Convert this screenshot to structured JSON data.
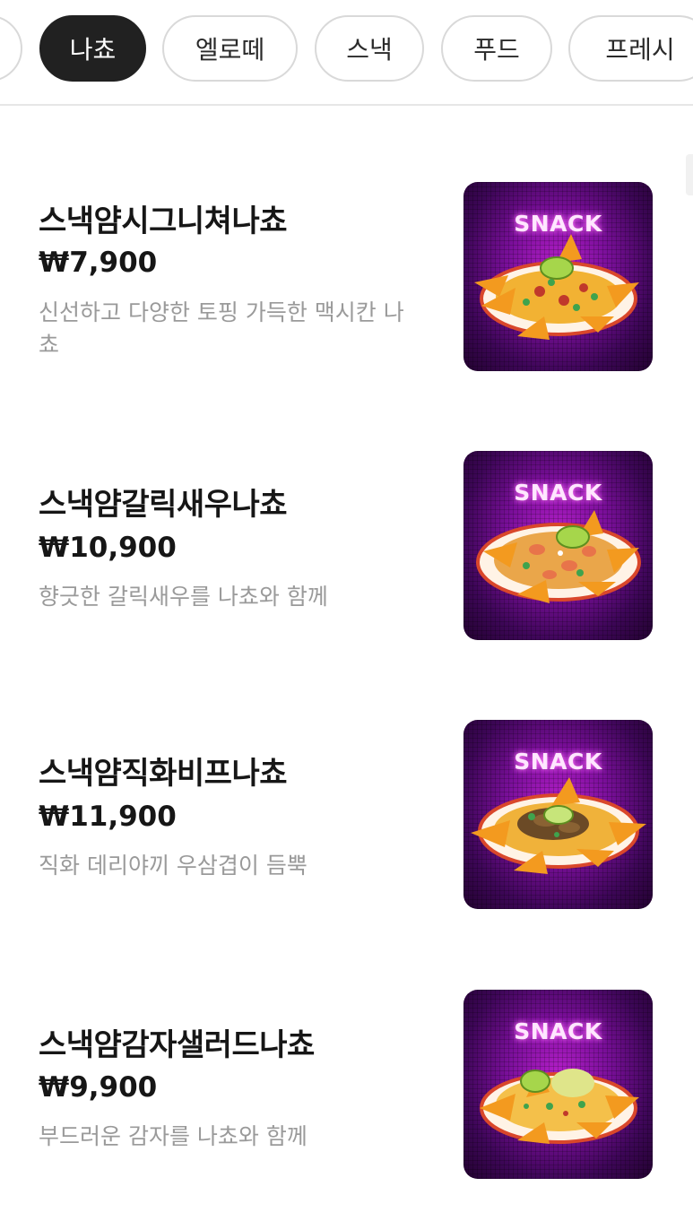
{
  "categories": [
    {
      "label": ""
    },
    {
      "label": "나쵸",
      "active": true
    },
    {
      "label": "엘로떼"
    },
    {
      "label": "스낵"
    },
    {
      "label": "푸드"
    },
    {
      "label": "프레시"
    }
  ],
  "menu_items": [
    {
      "name": "스낵얌시그니쳐나쵸",
      "price": "₩7,900",
      "description": "신선하고 다양한 토핑 가득한 맥시칸 나쵸",
      "image_badge": "SNACK",
      "image_icon": "nachos-plate-icon"
    },
    {
      "name": "스낵얌갈릭새우나쵸",
      "price": "₩10,900",
      "description": "향긋한 갈릭새우를 나쵸와 함께",
      "image_badge": "SNACK",
      "image_icon": "nachos-plate-icon"
    },
    {
      "name": "스낵얌직화비프나쵸",
      "price": "₩11,900",
      "description": "직화 데리야끼 우삼겹이 듬뿍",
      "image_badge": "SNACK",
      "image_icon": "nachos-plate-icon"
    },
    {
      "name": "스낵얌감자샐러드나쵸",
      "price": "₩9,900",
      "description": "부드러운 감자를 나쵸와 함께",
      "image_badge": "SNACK",
      "image_icon": "nachos-plate-icon"
    }
  ],
  "colors": {
    "active_chip": "#212121",
    "chip_border": "#d9d9d9",
    "description_text": "#9a9a9a",
    "thumbnail_purple": "#7a0f9a"
  }
}
